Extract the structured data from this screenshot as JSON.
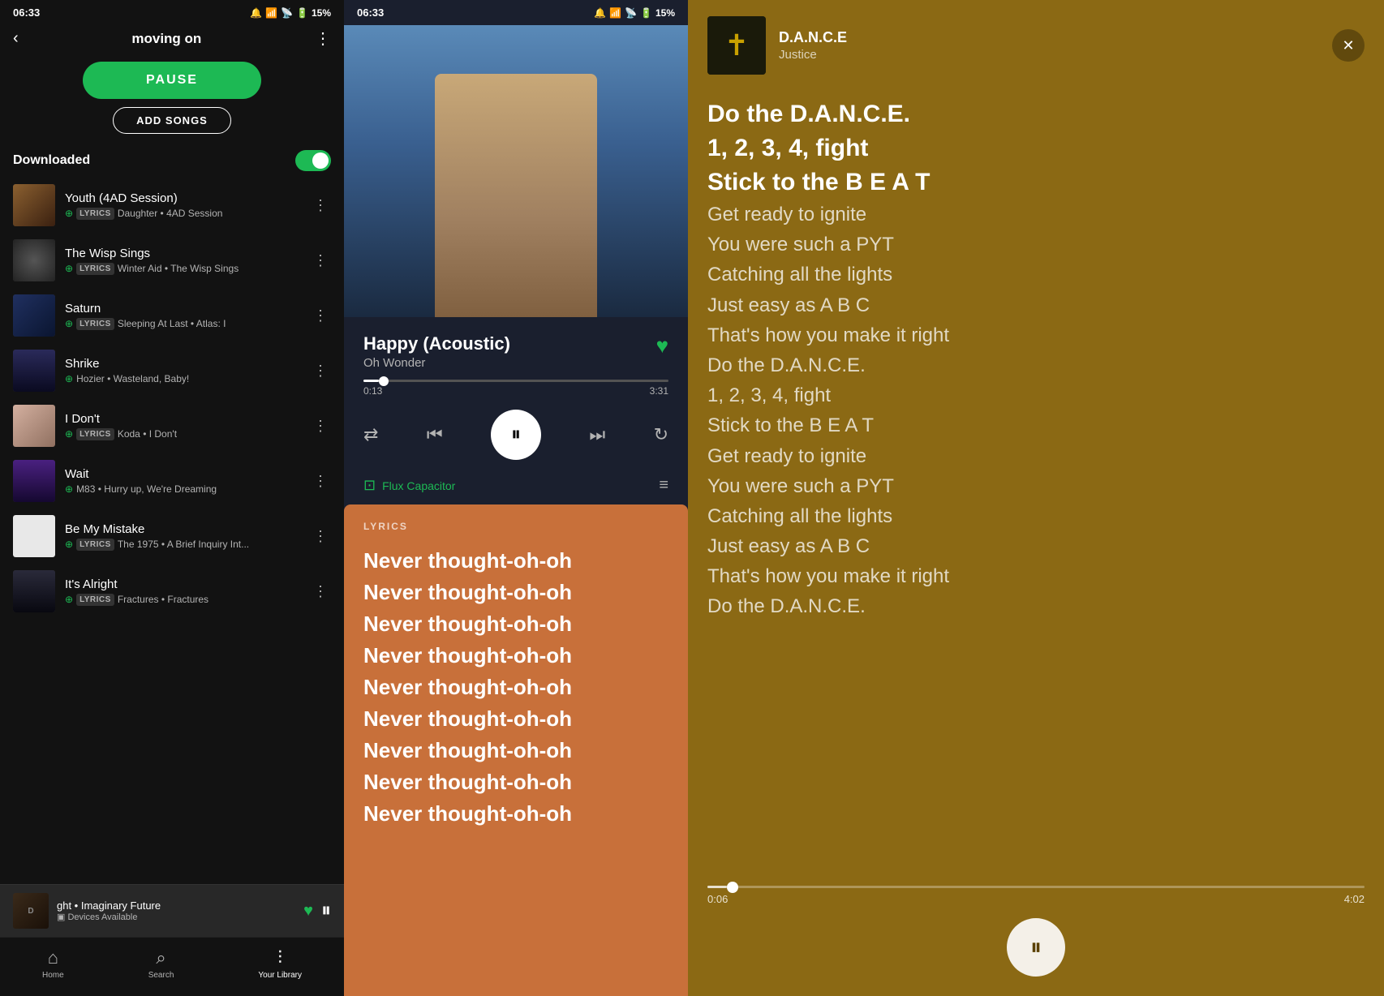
{
  "panel1": {
    "status_time": "06:33",
    "status_battery": "15%",
    "title": "moving on",
    "pause_label": "PAUSE",
    "add_songs_label": "ADD SONGS",
    "downloaded_label": "Downloaded",
    "songs": [
      {
        "id": "youth",
        "name": "Youth (4AD Session)",
        "artist": "Daughter • 4AD Session",
        "has_lyrics": true,
        "has_download": true,
        "art_class": "youth-art-inner"
      },
      {
        "id": "wisp",
        "name": "The Wisp Sings",
        "artist": "Winter Aid • The Wisp Sings",
        "has_lyrics": true,
        "has_download": true,
        "art_class": "wisp-art-inner"
      },
      {
        "id": "saturn",
        "name": "Saturn",
        "artist": "Sleeping At Last • Atlas: I",
        "has_lyrics": true,
        "has_download": true,
        "art_class": "saturn-art-inner"
      },
      {
        "id": "shrike",
        "name": "Shrike",
        "artist": "Hozier • Wasteland, Baby!",
        "has_lyrics": false,
        "has_download": true,
        "art_class": "shrike-art-inner"
      },
      {
        "id": "idont",
        "name": "I Don't",
        "artist": "Koda • I Don't",
        "has_lyrics": true,
        "has_download": true,
        "art_class": "idont-art-inner"
      },
      {
        "id": "wait",
        "name": "Wait",
        "artist": "M83 • Hurry up, We're Dreaming",
        "has_lyrics": false,
        "has_download": true,
        "art_class": "wait-art-inner"
      },
      {
        "id": "mistake",
        "name": "Be My Mistake",
        "artist": "The 1975 • A Brief Inquiry Int...",
        "has_lyrics": true,
        "has_download": true,
        "art_class": "mistake-art-inner"
      },
      {
        "id": "alright",
        "name": "It's Alright",
        "artist": "Fractures • Fractures",
        "has_lyrics": true,
        "has_download": true,
        "art_class": "alright-art-inner"
      }
    ],
    "now_playing": {
      "title": "ght • Imaginary Future",
      "sub": "Devices Available",
      "badge": "D"
    },
    "nav": {
      "home_label": "Home",
      "search_label": "Search",
      "library_label": "Your Library"
    }
  },
  "panel2": {
    "status_time": "06:33",
    "status_battery": "15%",
    "song_name": "Happy (Acoustic)",
    "artist": "Oh Wonder",
    "time_current": "0:13",
    "time_total": "3:31",
    "cast_device": "Flux Capacitor",
    "lyrics_label": "LYRICS",
    "lyrics_lines": [
      "Never thought-oh-oh",
      "Never thought-oh-oh",
      "Never thought-oh-oh",
      "Never thought-oh-oh",
      "Never thought-oh-oh",
      "Never thought-oh-oh",
      "Never thought-oh-oh",
      "Never thought-oh-oh",
      "Never thought-oh-oh"
    ]
  },
  "panel3": {
    "song_name": "D.A.N.C.E",
    "artist": "Justice",
    "title": "Do the DANCE",
    "time_current": "0:06",
    "time_total": "4:02",
    "lyrics": [
      {
        "text": "Do the D.A.N.C.E.",
        "bold": true
      },
      {
        "text": "1, 2, 3, 4, fight",
        "bold": true
      },
      {
        "text": "Stick to the B E A T",
        "bold": true
      },
      {
        "text": "Get ready to ignite",
        "bold": false
      },
      {
        "text": "You were such a PYT",
        "bold": false
      },
      {
        "text": "Catching all the lights",
        "bold": false
      },
      {
        "text": "Just easy as A B C",
        "bold": false
      },
      {
        "text": "That's how you make it right",
        "bold": false
      },
      {
        "text": "Do the D.A.N.C.E.",
        "bold": false
      },
      {
        "text": "1, 2, 3, 4, fight",
        "bold": false
      },
      {
        "text": "Stick to the B E A T",
        "bold": false
      },
      {
        "text": "Get ready to ignite",
        "bold": false
      },
      {
        "text": "You were such a PYT",
        "bold": false
      },
      {
        "text": "Catching all the lights",
        "bold": false
      },
      {
        "text": "Just easy as A B C",
        "bold": false
      },
      {
        "text": "That's how you make it right",
        "bold": false
      },
      {
        "text": "Do the D.A.N.C.E.",
        "bold": false
      }
    ]
  }
}
